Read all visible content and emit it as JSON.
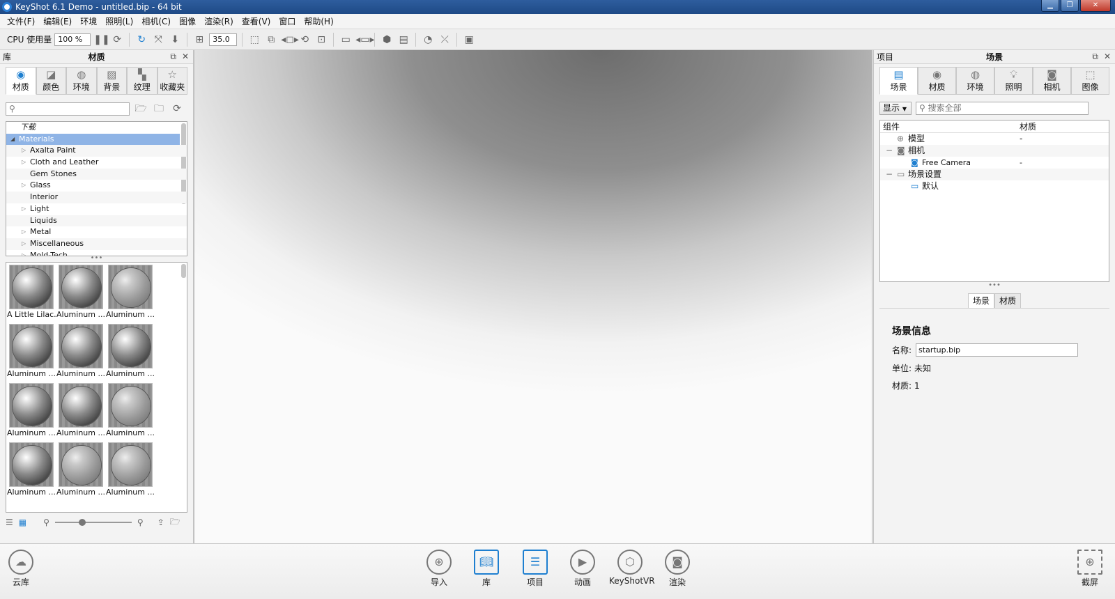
{
  "window": {
    "title": "KeyShot 6.1 Demo  - untitled.bip  - 64 bit"
  },
  "menu": [
    "文件(F)",
    "编辑(E)",
    "环境",
    "照明(L)",
    "相机(C)",
    "图像",
    "渲染(R)",
    "查看(V)",
    "窗口",
    "帮助(H)"
  ],
  "toolbar": {
    "cpu_label": "CPU 使用量",
    "cpu_value": "100 %",
    "fov_value": "35.0"
  },
  "library": {
    "side_label": "库",
    "title": "材质",
    "tabs": [
      "材质",
      "颜色",
      "环境",
      "背景",
      "纹理",
      "收藏夹"
    ],
    "search_placeholder": "",
    "tree": [
      "下载",
      "Materials",
      "Axalta Paint",
      "Cloth and Leather",
      "Gem Stones",
      "Glass",
      "Interior",
      "Light",
      "Liquids",
      "Metal",
      "Miscellaneous",
      "Mold-Tech"
    ],
    "thumbnails": [
      "A Little Lilac...",
      "Aluminum ...",
      "Aluminum ...",
      "Aluminum ...",
      "Aluminum ...",
      "Aluminum ...",
      "Aluminum ...",
      "Aluminum ...",
      "Aluminum ...",
      "Aluminum ...",
      "Aluminum ...",
      "Aluminum ..."
    ]
  },
  "project": {
    "side_label": "项目",
    "title": "场景",
    "tabs": [
      "场景",
      "材质",
      "环境",
      "照明",
      "相机",
      "图像"
    ],
    "show_label": "显示",
    "search_placeholder": "搜索全部",
    "col_component": "组件",
    "col_material": "材质",
    "rows": [
      {
        "name": "模型",
        "material": "-"
      },
      {
        "name": "相机",
        "material": ""
      },
      {
        "name": "Free Camera",
        "material": "-"
      },
      {
        "name": "场景设置",
        "material": ""
      },
      {
        "name": "默认",
        "material": ""
      }
    ],
    "subtabs": [
      "场景",
      "材质"
    ],
    "info_title": "场景信息",
    "name_label": "名称:",
    "name_value": "startup.bip",
    "unit_label": "单位:",
    "unit_value": "未知",
    "material_label": "材质:",
    "material_value": "1"
  },
  "bottom": {
    "cloud": "云库",
    "buttons": [
      "导入",
      "库",
      "项目",
      "动画",
      "KeyShotVR",
      "渲染"
    ],
    "screenshot": "截屏"
  }
}
